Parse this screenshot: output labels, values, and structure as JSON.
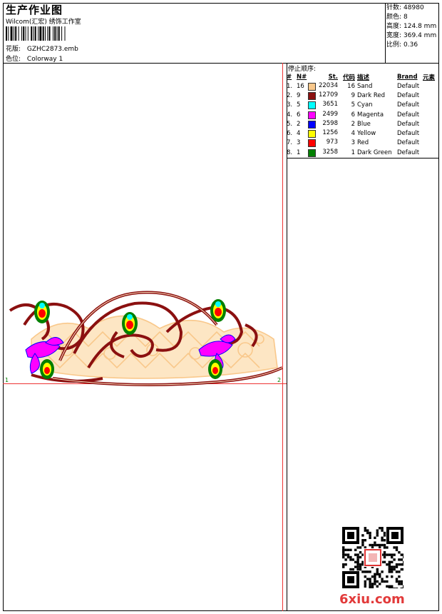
{
  "header": {
    "title": "生产作业图",
    "subtitle": "Wilcom(汇宏) 绣饰工作室",
    "file_label": "花版:",
    "file_name": "GZHC2873.emb",
    "colorway_label": "色位:",
    "colorway_name": "Colorway 1"
  },
  "stats": [
    {
      "label": "针数:",
      "value": "48980"
    },
    {
      "label": "颜色:",
      "value": "8"
    },
    {
      "label": "高度:",
      "value": "124.8 mm"
    },
    {
      "label": "宽度:",
      "value": "369.4 mm"
    },
    {
      "label": "比例:",
      "value": "0.36"
    }
  ],
  "stop_sequence": {
    "title": "停止顺序:",
    "headers": [
      "#",
      "N#",
      "St.",
      "代码",
      "描述",
      "Brand",
      "元素"
    ],
    "rows": [
      {
        "idx": "1.",
        "n": "16",
        "color": "#F9C88B",
        "stitches": "22034",
        "code": "16",
        "desc": "Sand",
        "brand": "Default"
      },
      {
        "idx": "2.",
        "n": "9",
        "color": "#8B1010",
        "stitches": "12709",
        "code": "9",
        "desc": "Dark Red",
        "brand": "Default"
      },
      {
        "idx": "3.",
        "n": "5",
        "color": "#00FFFF",
        "stitches": "3651",
        "code": "5",
        "desc": "Cyan",
        "brand": "Default"
      },
      {
        "idx": "4.",
        "n": "6",
        "color": "#FF00FF",
        "stitches": "2499",
        "code": "6",
        "desc": "Magenta",
        "brand": "Default"
      },
      {
        "idx": "5.",
        "n": "2",
        "color": "#0000FF",
        "stitches": "2598",
        "code": "2",
        "desc": "Blue",
        "brand": "Default"
      },
      {
        "idx": "6.",
        "n": "4",
        "color": "#FFFF00",
        "stitches": "1256",
        "code": "4",
        "desc": "Yellow",
        "brand": "Default"
      },
      {
        "idx": "7.",
        "n": "3",
        "color": "#FF0000",
        "stitches": "973",
        "code": "3",
        "desc": "Red",
        "brand": "Default"
      },
      {
        "idx": "8.",
        "n": "1",
        "color": "#008000",
        "stitches": "3258",
        "code": "1",
        "desc": "Dark Green",
        "brand": "Default"
      }
    ]
  },
  "markers": {
    "left": "1",
    "right": "2"
  },
  "watermark": "6xiu.com"
}
